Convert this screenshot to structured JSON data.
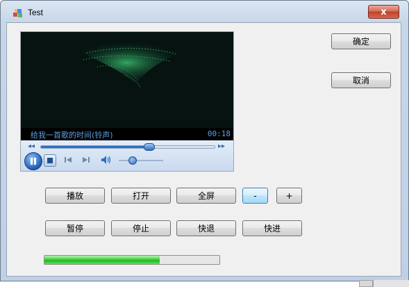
{
  "window": {
    "title": "Test",
    "close_glyph": "x"
  },
  "side_buttons": {
    "ok": "确定",
    "cancel": "取消"
  },
  "player": {
    "track_title": "给我一首歌的时间(铃声)",
    "time": "00:18",
    "seek_fraction": 0.62,
    "volume_fraction": 0.3,
    "icons": [
      "pause-icon",
      "stop-icon",
      "previous-icon",
      "next-icon",
      "volume-icon",
      "rewind-icon",
      "fast-forward-icon"
    ]
  },
  "row1": {
    "play": "播放",
    "open": "打开",
    "fullscreen": "全屏",
    "minus": "-",
    "plus": "+"
  },
  "row2": {
    "pause": "暂停",
    "stop": "停止",
    "rewind": "快退",
    "forward": "快进"
  },
  "progress": {
    "fraction": 0.66,
    "color": "#22c022"
  },
  "colors": {
    "accent": "#2f6fc1",
    "title_text": "#5c9fe6"
  }
}
